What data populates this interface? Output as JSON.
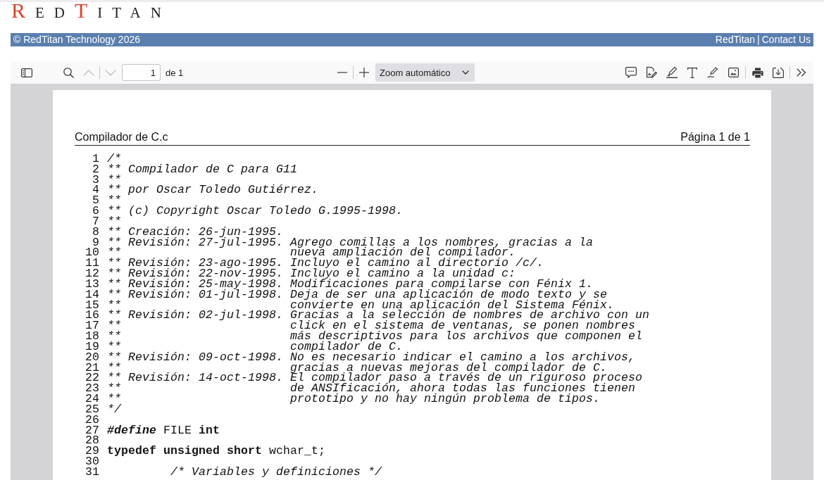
{
  "logo": [
    {
      "text": "R",
      "kind": "initial"
    },
    {
      "text": "ED",
      "kind": "rest"
    },
    {
      "text": "T",
      "kind": "initial"
    },
    {
      "text": "ITAN",
      "kind": "rest"
    }
  ],
  "banner": {
    "copyright": "© RedTitan Technology 2026",
    "links": [
      "RedTitan",
      "Contact Us"
    ],
    "link_separator": "|"
  },
  "toolbar": {
    "previous_page": {
      "disabled": true
    },
    "next_page": {
      "disabled": true
    },
    "page_input": {
      "value": "1"
    },
    "page_count": "de 1",
    "zoom_select": {
      "value": "Zoom automático"
    }
  },
  "document": {
    "header_left": "Compilador de C.c",
    "header_right": "Página 1 de 1",
    "lines": [
      {
        "number": "1",
        "segments": [
          {
            "kind": "comment",
            "text": "/*"
          }
        ]
      },
      {
        "number": "2",
        "segments": [
          {
            "kind": "comment",
            "text": "** Compilador de C para G11"
          }
        ]
      },
      {
        "number": "3",
        "segments": [
          {
            "kind": "comment",
            "text": "**"
          }
        ]
      },
      {
        "number": "4",
        "segments": [
          {
            "kind": "comment",
            "text": "** por Oscar Toledo Gutiérrez."
          }
        ]
      },
      {
        "number": "5",
        "segments": [
          {
            "kind": "comment",
            "text": "**"
          }
        ]
      },
      {
        "number": "6",
        "segments": [
          {
            "kind": "comment",
            "text": "** (c) Copyright Oscar Toledo G.1995-1998."
          }
        ]
      },
      {
        "number": "7",
        "segments": [
          {
            "kind": "comment",
            "text": "**"
          }
        ]
      },
      {
        "number": "8",
        "segments": [
          {
            "kind": "comment",
            "text": "** Creación: 26-jun-1995."
          }
        ]
      },
      {
        "number": "9",
        "segments": [
          {
            "kind": "comment",
            "text": "** Revisión: 27-jul-1995. Agrego comillas a los nombres, gracias a la"
          }
        ]
      },
      {
        "number": "10",
        "segments": [
          {
            "kind": "comment",
            "text": "**                        nueva ampliación del compilador."
          }
        ]
      },
      {
        "number": "11",
        "segments": [
          {
            "kind": "comment",
            "text": "** Revisión: 23-ago-1995. Incluyo el camino al directorio /c/."
          }
        ]
      },
      {
        "number": "12",
        "segments": [
          {
            "kind": "comment",
            "text": "** Revisión: 22-nov-1995. Incluyo el camino a la unidad c:"
          }
        ]
      },
      {
        "number": "13",
        "segments": [
          {
            "kind": "comment",
            "text": "** Revisión: 25-may-1998. Modificaciones para compilarse con Fénix 1."
          }
        ]
      },
      {
        "number": "14",
        "segments": [
          {
            "kind": "comment",
            "text": "** Revisión: 01-jul-1998. Deja de ser una aplicación de modo texto y se"
          }
        ]
      },
      {
        "number": "15",
        "segments": [
          {
            "kind": "comment",
            "text": "**                        convierte en una aplicación del Sistema Fénix."
          }
        ]
      },
      {
        "number": "16",
        "segments": [
          {
            "kind": "comment",
            "text": "** Revisión: 02-jul-1998. Gracias a la selección de nombres de archivo con un"
          }
        ]
      },
      {
        "number": "17",
        "segments": [
          {
            "kind": "comment",
            "text": "**                        click en el sistema de ventanas, se ponen nombres"
          }
        ]
      },
      {
        "number": "18",
        "segments": [
          {
            "kind": "comment",
            "text": "**                        más descriptivos para los archivos que componen el"
          }
        ]
      },
      {
        "number": "19",
        "segments": [
          {
            "kind": "comment",
            "text": "**                        compilador de C."
          }
        ]
      },
      {
        "number": "20",
        "segments": [
          {
            "kind": "comment",
            "text": "** Revisión: 09-oct-1998. No es necesario indicar el camino a los archivos,"
          }
        ]
      },
      {
        "number": "21",
        "segments": [
          {
            "kind": "comment",
            "text": "**                        gracias a nuevas mejoras del compilador de C."
          }
        ]
      },
      {
        "number": "22",
        "segments": [
          {
            "kind": "comment",
            "text": "** Revisión: 14-oct-1998. El compilador paso a través de un riguroso proceso"
          }
        ]
      },
      {
        "number": "23",
        "segments": [
          {
            "kind": "comment",
            "text": "**                        de ANSIficación, ahora todas las funciones tienen"
          }
        ]
      },
      {
        "number": "24",
        "segments": [
          {
            "kind": "comment",
            "text": "**                        prototipo y no hay ningún problema de tipos."
          }
        ]
      },
      {
        "number": "25",
        "segments": [
          {
            "kind": "comment",
            "text": "*/"
          }
        ]
      },
      {
        "number": "26"
      },
      {
        "number": "27",
        "segments": [
          {
            "kind": "directive",
            "text": "#define"
          },
          {
            "kind": "plain",
            "text": " FILE "
          },
          {
            "kind": "keyword",
            "text": "int"
          }
        ]
      },
      {
        "number": "28"
      },
      {
        "number": "29",
        "segments": [
          {
            "kind": "keyword",
            "text": "typedef unsigned short"
          },
          {
            "kind": "plain",
            "text": " wchar_t;"
          }
        ]
      },
      {
        "number": "30"
      },
      {
        "number": "31",
        "segments": [
          {
            "kind": "comment",
            "text": "         /* Variables y definiciones */"
          }
        ]
      }
    ]
  }
}
